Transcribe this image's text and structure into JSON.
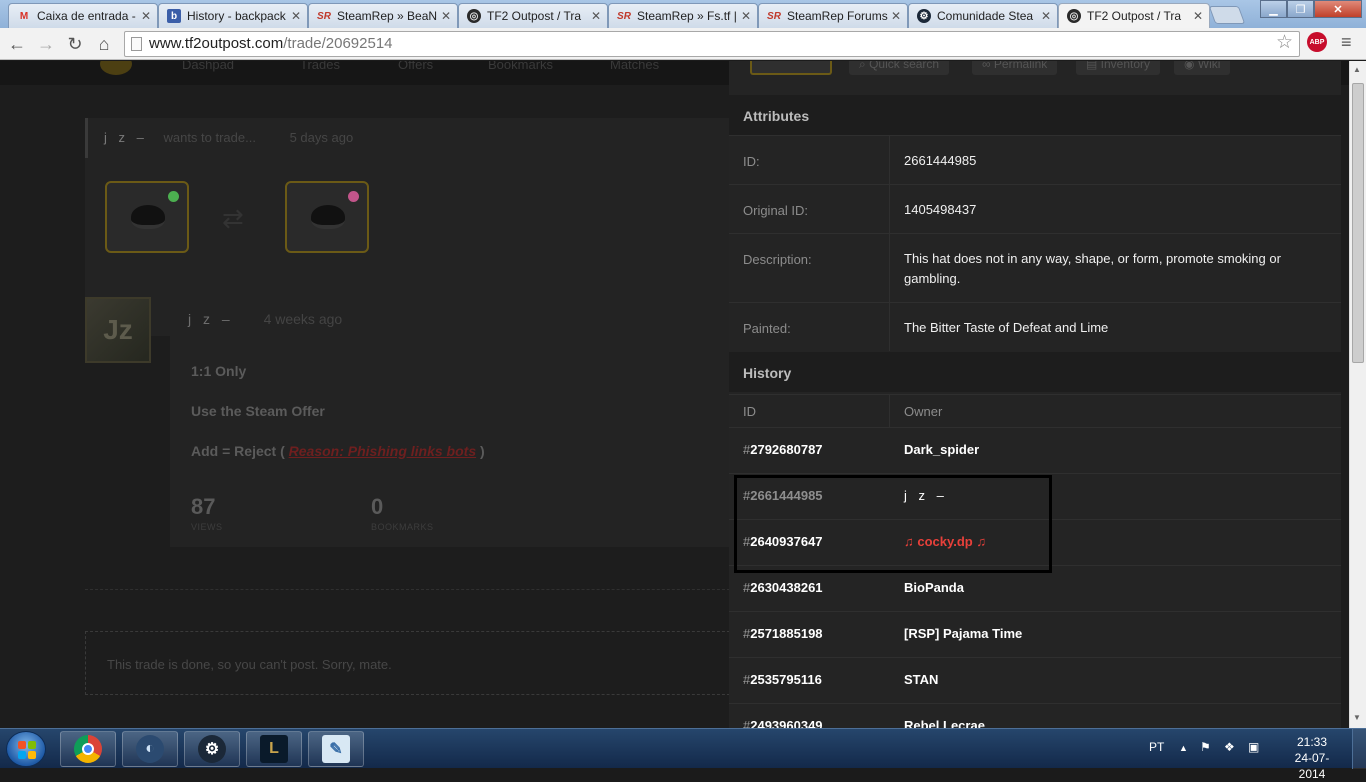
{
  "browser": {
    "tabs": [
      {
        "label": "Caixa de entrada - ",
        "icon": "gmail-icon"
      },
      {
        "label": "History - backpack",
        "icon": "backpack-icon"
      },
      {
        "label": "SteamRep » BeaN",
        "icon": "steamrep-icon"
      },
      {
        "label": "TF2 Outpost / Tra",
        "icon": "tf2outpost-icon"
      },
      {
        "label": "SteamRep » Fs.tf |",
        "icon": "steamrep-icon"
      },
      {
        "label": "SteamRep Forums",
        "icon": "steamrep-icon"
      },
      {
        "label": "Comunidade Stea",
        "icon": "steam-icon"
      },
      {
        "label": "TF2 Outpost / Tra",
        "icon": "tf2outpost-icon"
      }
    ],
    "url_host": "www.tf2outpost.com",
    "url_path": "/trade/20692514"
  },
  "page": {
    "nav": [
      "Dashpad",
      "Trades",
      "Offers",
      "Bookmarks",
      "Matches"
    ],
    "trade": {
      "user": "j z –",
      "action": "wants to trade...",
      "time": "5 days ago"
    },
    "post": {
      "user": "j z –",
      "time": "4 weeks ago",
      "avatar_text": "Jz",
      "line1": "1:1 Only",
      "line2": "Use the Steam Offer",
      "line3_prefix": "Add = Reject (",
      "line3_link": "Reason: Phishing links bots",
      "line3_suffix": ")",
      "views": "87",
      "views_label": "VIEWS",
      "bookmarks": "0",
      "bookmarks_label": "BOOKMARKS"
    },
    "done_text": "This trade is done, so you can't post. Sorry, mate."
  },
  "panel": {
    "tools": [
      "Quick search",
      "Permalink",
      "Inventory",
      "Wiki"
    ],
    "attributes_title": "Attributes",
    "attributes": [
      {
        "key": "ID:",
        "value": "2661444985"
      },
      {
        "key": "Original ID:",
        "value": "1405498437"
      },
      {
        "key": "Description:",
        "value": "This hat does not in any way, shape, or form, promote smoking or gambling."
      },
      {
        "key": "Painted:",
        "value": "The Bitter Taste of Defeat and Lime"
      }
    ],
    "history_title": "History",
    "history_cols": {
      "id": "ID",
      "owner": "Owner"
    },
    "history": [
      {
        "id": "2792680787",
        "owner": "Dark_spider"
      },
      {
        "id": "2661444985",
        "owner": "j z –"
      },
      {
        "id": "2640937647",
        "owner": "♫ cocky.dp ♫"
      },
      {
        "id": "2630438261",
        "owner": "BioPanda"
      },
      {
        "id": "2571885198",
        "owner": "[RSP] Pajama Time"
      },
      {
        "id": "2535795116",
        "owner": "STAN"
      },
      {
        "id": "2493960349",
        "owner": "Rebel Lecrae"
      }
    ]
  },
  "taskbar": {
    "language": "PT",
    "time": "21:33",
    "date": "24-07-2014"
  },
  "colors": {
    "paint_dot_1": "#4caf50",
    "paint_dot_2": "#c2558a",
    "scammer_red": "#e8403a"
  }
}
